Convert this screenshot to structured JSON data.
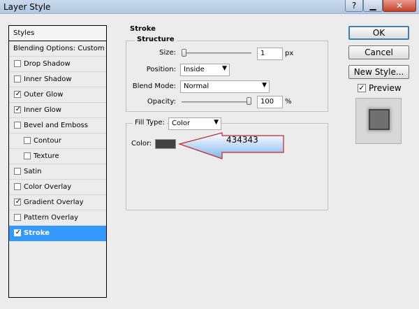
{
  "window": {
    "title": "Layer Style"
  },
  "titlebar_icons": {
    "help": "?",
    "minimize": "▁",
    "close": "✕"
  },
  "styles_list": {
    "header": "Styles",
    "items": [
      {
        "label": "Blending Options: Custom",
        "checkbox": false,
        "checked": false,
        "indent": false,
        "selected": false
      },
      {
        "label": "Drop Shadow",
        "checkbox": true,
        "checked": false,
        "indent": false,
        "selected": false
      },
      {
        "label": "Inner Shadow",
        "checkbox": true,
        "checked": false,
        "indent": false,
        "selected": false
      },
      {
        "label": "Outer Glow",
        "checkbox": true,
        "checked": true,
        "indent": false,
        "selected": false
      },
      {
        "label": "Inner Glow",
        "checkbox": true,
        "checked": true,
        "indent": false,
        "selected": false
      },
      {
        "label": "Bevel and Emboss",
        "checkbox": true,
        "checked": false,
        "indent": false,
        "selected": false
      },
      {
        "label": "Contour",
        "checkbox": true,
        "checked": false,
        "indent": true,
        "selected": false
      },
      {
        "label": "Texture",
        "checkbox": true,
        "checked": false,
        "indent": true,
        "selected": false
      },
      {
        "label": "Satin",
        "checkbox": true,
        "checked": false,
        "indent": false,
        "selected": false
      },
      {
        "label": "Color Overlay",
        "checkbox": true,
        "checked": false,
        "indent": false,
        "selected": false
      },
      {
        "label": "Gradient Overlay",
        "checkbox": true,
        "checked": true,
        "indent": false,
        "selected": false
      },
      {
        "label": "Pattern Overlay",
        "checkbox": true,
        "checked": false,
        "indent": false,
        "selected": false
      },
      {
        "label": "Stroke",
        "checkbox": true,
        "checked": true,
        "indent": false,
        "selected": true
      }
    ]
  },
  "stroke": {
    "title": "Stroke",
    "structure": {
      "label": "Structure",
      "size_label": "Size:",
      "size_value": "1",
      "size_unit": "px",
      "size_fraction": 0.0,
      "position_label": "Position:",
      "position_value": "Inside",
      "blend_mode_label": "Blend Mode:",
      "blend_mode_value": "Normal",
      "opacity_label": "Opacity:",
      "opacity_value": "100",
      "opacity_unit": "%",
      "opacity_fraction": 1.0
    },
    "fill": {
      "fill_type_label": "Fill Type:",
      "fill_type_value": "Color",
      "color_label": "Color:",
      "color_hex": "#434343"
    }
  },
  "annotation": {
    "text": "434343"
  },
  "buttons": {
    "ok": "OK",
    "cancel": "Cancel",
    "new_style": "New Style..."
  },
  "preview": {
    "label": "Preview",
    "checked": true
  },
  "glyphs": {
    "check": "✓",
    "dropdown": "▼"
  },
  "colors": {
    "selection": "#3399ff",
    "stroke_color": "#434343",
    "annotation_border": "#cc2222",
    "annotation_fill_top": "#ffffff",
    "annotation_fill_bottom": "#7fb6ef"
  }
}
